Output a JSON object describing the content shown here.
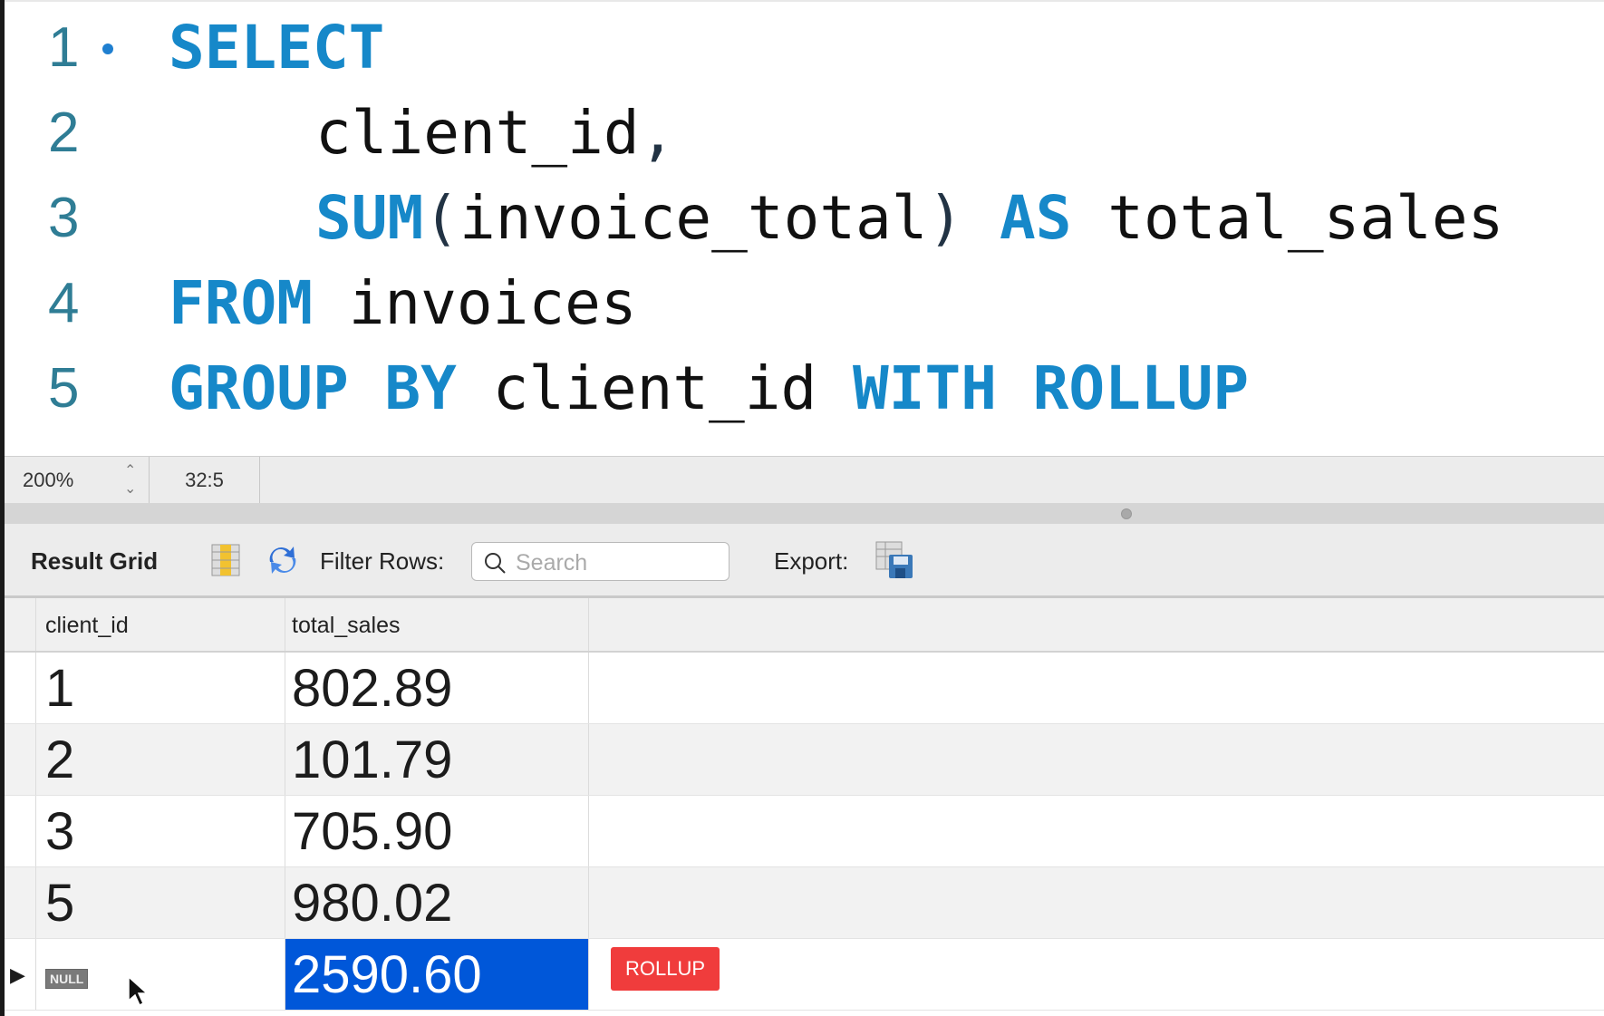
{
  "editor": {
    "lines": [
      {
        "num": "1",
        "parts": [
          "SELECT"
        ]
      },
      {
        "num": "2",
        "parts": [
          "client_id",
          ","
        ]
      },
      {
        "num": "3",
        "parts": [
          "SUM",
          "(",
          "invoice_total",
          ")",
          " AS",
          " total_sales"
        ]
      },
      {
        "num": "4",
        "parts": [
          "FROM",
          " invoices"
        ]
      },
      {
        "num": "5",
        "parts": [
          "GROUP BY",
          " client_id ",
          "WITH ROLLUP"
        ]
      }
    ]
  },
  "status": {
    "zoom": "200%",
    "cursor": "32:5"
  },
  "toolbar": {
    "result_grid": "Result Grid",
    "filter_label": "Filter Rows:",
    "search_placeholder": "Search",
    "export_label": "Export:"
  },
  "grid": {
    "columns": [
      "client_id",
      "total_sales"
    ],
    "rows": [
      [
        "1",
        "802.89"
      ],
      [
        "2",
        "101.79"
      ],
      [
        "3",
        "705.90"
      ],
      [
        "5",
        "980.02"
      ],
      [
        "NULL",
        "2590.60"
      ]
    ]
  },
  "annotation": "ROLLUP"
}
